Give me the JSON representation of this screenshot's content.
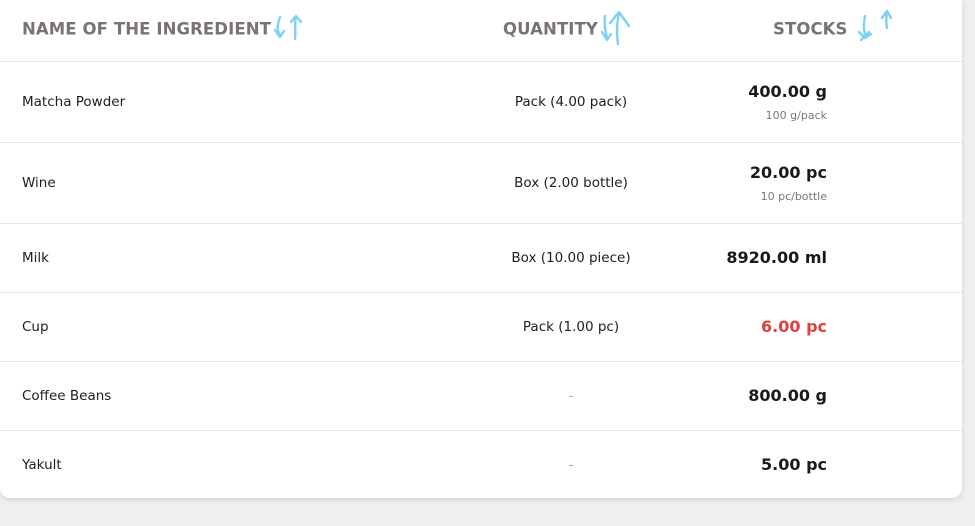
{
  "table": {
    "headers": {
      "name": "NAME OF THE INGREDIENT",
      "quantity": "QUANTITY",
      "stocks": "STOCKS"
    },
    "sort_icon_color": "#7fd0f5",
    "low_stock_color": "#e0403f",
    "rows": [
      {
        "name": "Matcha Powder",
        "quantity": "Pack (4.00 pack)",
        "stock": "400.00 g",
        "unit_rate": "100 g/pack",
        "low": false
      },
      {
        "name": "Wine",
        "quantity": "Box (2.00 bottle)",
        "stock": "20.00 pc",
        "unit_rate": "10 pc/bottle",
        "low": false
      },
      {
        "name": "Milk",
        "quantity": "Box (10.00 piece)",
        "stock": "8920.00 ml",
        "unit_rate": "",
        "low": false
      },
      {
        "name": "Cup",
        "quantity": "Pack (1.00 pc)",
        "stock": "6.00 pc",
        "unit_rate": "",
        "low": true
      },
      {
        "name": "Coffee Beans",
        "quantity": "-",
        "stock": "800.00 g",
        "unit_rate": "",
        "low": false
      },
      {
        "name": "Yakult",
        "quantity": "-",
        "stock": "5.00 pc",
        "unit_rate": "",
        "low": false
      }
    ]
  }
}
